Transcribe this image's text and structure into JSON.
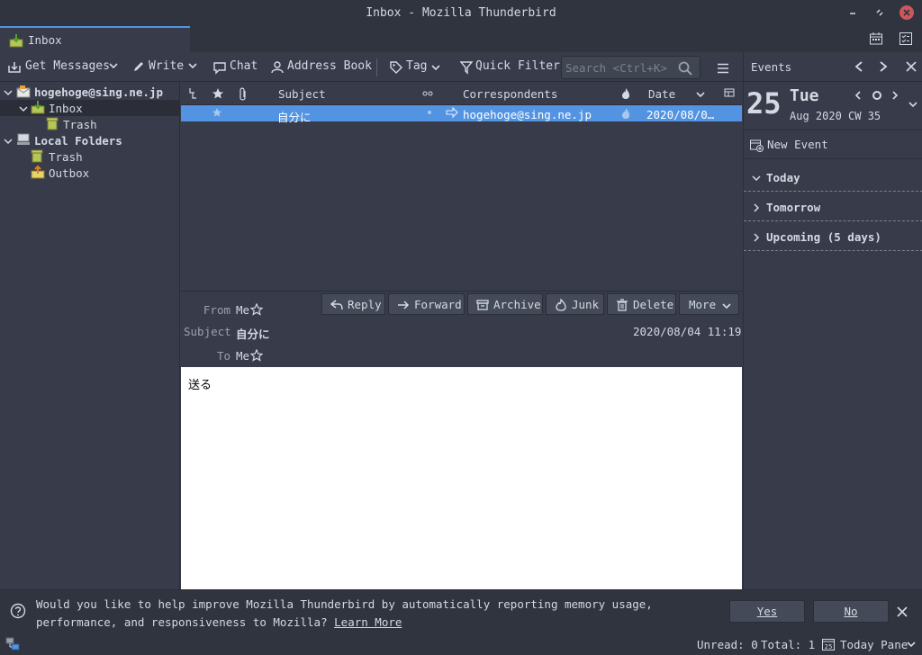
{
  "window": {
    "title": "Inbox - Mozilla Thunderbird"
  },
  "tabs": [
    {
      "label": "Inbox"
    }
  ],
  "toolbar": {
    "get_messages": "Get Messages",
    "write": "Write",
    "chat": "Chat",
    "address_book": "Address Book",
    "tag": "Tag",
    "quick_filter": "Quick Filter",
    "search_placeholder": "Search <Ctrl+K>"
  },
  "folders": {
    "account": "hogehoge@sing.ne.jp",
    "inbox": "Inbox",
    "inbox_trash": "Trash",
    "local_folders": "Local Folders",
    "local_trash": "Trash",
    "outbox": "Outbox"
  },
  "thread": {
    "columns": {
      "subject": "Subject",
      "correspondents": "Correspondents",
      "date": "Date"
    },
    "rows": [
      {
        "subject": "自分に",
        "correspondent": "hogehoge@sing.ne.jp",
        "date": "2020/08/0…"
      }
    ]
  },
  "message": {
    "buttons": {
      "reply": "Reply",
      "forward": "Forward",
      "archive": "Archive",
      "junk": "Junk",
      "delete": "Delete",
      "more": "More"
    },
    "labels": {
      "from": "From",
      "subject": "Subject",
      "to": "To"
    },
    "from": "Me",
    "subject": "自分に",
    "to": "Me",
    "date": "2020/08/04 11:19",
    "body": "送る"
  },
  "today_pane": {
    "title": "Events",
    "day": "25",
    "weekday": "Tue",
    "month_info": "Aug 2020 CW 35",
    "new_event": "New Event",
    "sections": {
      "today": "Today",
      "tomorrow": "Tomorrow",
      "upcoming": "Upcoming (5 days)"
    }
  },
  "notification": {
    "text": "Would you like to help improve Mozilla Thunderbird by automatically reporting memory usage, performance, and responsiveness to Mozilla?",
    "link": "Learn More",
    "yes": "Yes",
    "no": "No"
  },
  "status": {
    "unread": "Unread: 0",
    "total": "Total: 1",
    "today_pane": "Today Pane"
  },
  "colors": {
    "accent": "#5294e2",
    "background": "#383c4a",
    "chrome": "#2f343f",
    "close": "#cc575d"
  }
}
